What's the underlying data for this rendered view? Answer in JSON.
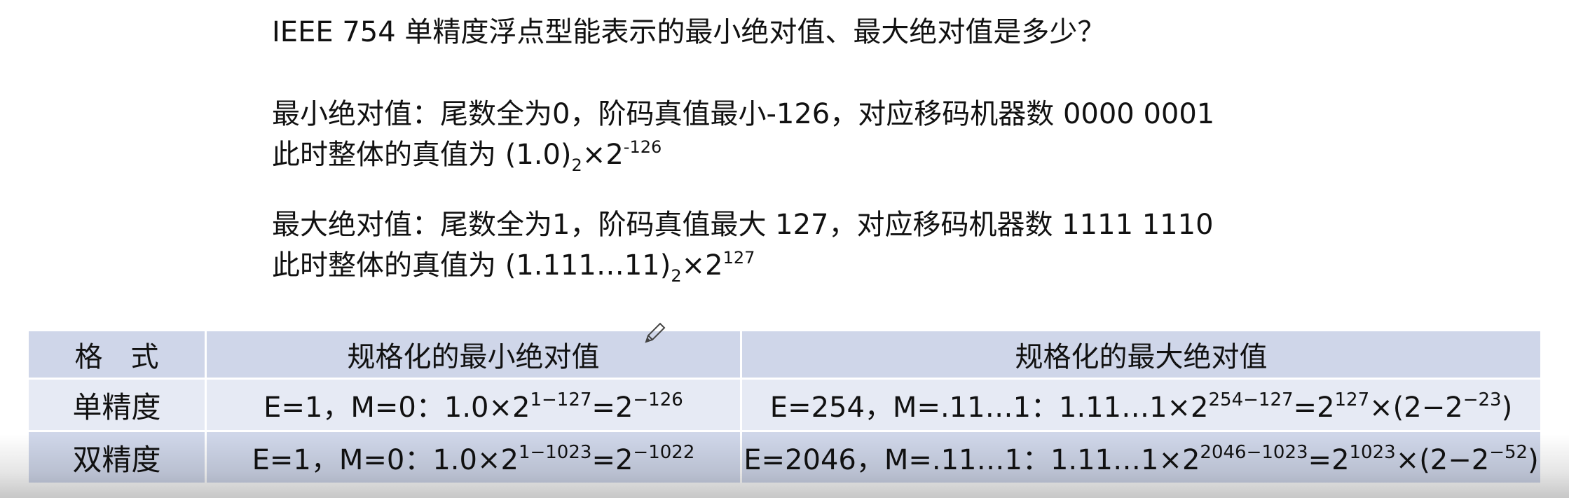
{
  "question": "IEEE 754 单精度浮点型能表示的最小绝对值、最大绝对值是多少？",
  "min_abs": {
    "line1": "最小绝对值：尾数全为0，阶码真值最小-126，对应移码机器数 0000 0001",
    "line2_prefix": "此时整体的真值为 (1.0)",
    "line2_base_sub": "2",
    "line2_mid": "×2",
    "line2_exp": "-126"
  },
  "max_abs": {
    "line1": "最大绝对值：尾数全为1，阶码真值最大 127，对应移码机器数 1111 1110",
    "line2_prefix": "此时整体的真值为 (1.111…11)",
    "line2_base_sub": "2",
    "line2_mid": "×2",
    "line2_exp": "127"
  },
  "table": {
    "headers": [
      "格　式",
      "规格化的最小绝对值",
      "规格化的最大绝对值"
    ],
    "rows": [
      {
        "format": "单精度",
        "min": {
          "a": "E=1，M=0：1.0×2",
          "e1": "1−127",
          "b": "=2",
          "e2": "−126"
        },
        "max": {
          "a": "E=254，M=.11…1：1.11…1×2",
          "e1": "254−127",
          "b": "=2",
          "e2": "127",
          "c": "×(2−2",
          "e3": "−23",
          "d": ")"
        }
      },
      {
        "format": "双精度",
        "min": {
          "a": "E=1，M=0：1.0×2",
          "e1": "1−1023",
          "b": "=2",
          "e2": "−1022"
        },
        "max": {
          "a": "E=2046，M=.11…1：1.11…1×2",
          "e1": "2046−1023",
          "b": "=2",
          "e2": "1023",
          "c": "×(2−2",
          "e3": "−52",
          "d": ")"
        }
      }
    ]
  },
  "colors": {
    "header_row": "#cfd6e9",
    "row_light": "#e6eaf4",
    "row_dark": "#cfd6e9",
    "text": "#111111"
  },
  "icons": [
    "pencil-cursor-icon"
  ]
}
